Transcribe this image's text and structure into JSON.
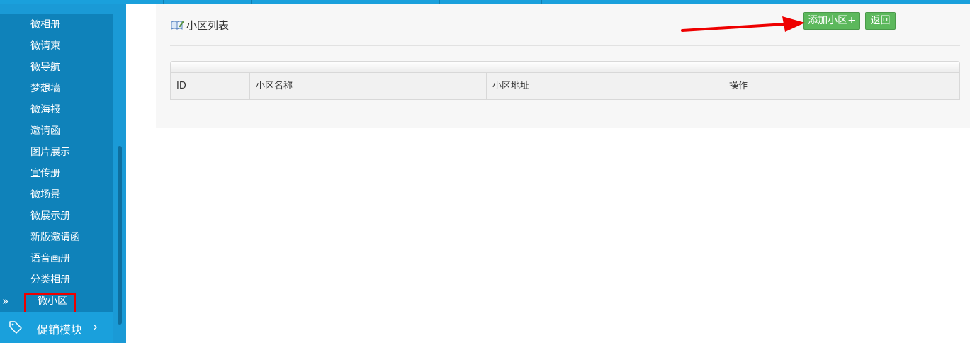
{
  "sidebar": {
    "submenu_items": [
      {
        "label": "微相册"
      },
      {
        "label": "微请柬"
      },
      {
        "label": "微导航"
      },
      {
        "label": "梦想墙"
      },
      {
        "label": "微海报"
      },
      {
        "label": "邀请函"
      },
      {
        "label": "图片展示"
      },
      {
        "label": "宣传册"
      },
      {
        "label": "微场景"
      },
      {
        "label": "微展示册"
      },
      {
        "label": "新版邀请函"
      },
      {
        "label": "语音画册"
      },
      {
        "label": "分类相册"
      }
    ],
    "active_item": {
      "label": "微小区",
      "marker": "»"
    },
    "group": {
      "label": "促销模块",
      "chevron": "›",
      "icon": "tag-icon"
    }
  },
  "panel": {
    "title": "小区列表",
    "title_icon": "book-edit-icon",
    "buttons": {
      "add_label": "添加小区+",
      "back_label": "返回"
    },
    "table": {
      "columns": [
        "ID",
        "小区名称",
        "小区地址",
        "操作"
      ]
    }
  },
  "colors": {
    "sidebar": "#1a9ad6",
    "submenu": "#0f82ba",
    "button": "#5cb85c",
    "highlight": "#ee0000",
    "annotation_arrow": "#ee0000"
  }
}
